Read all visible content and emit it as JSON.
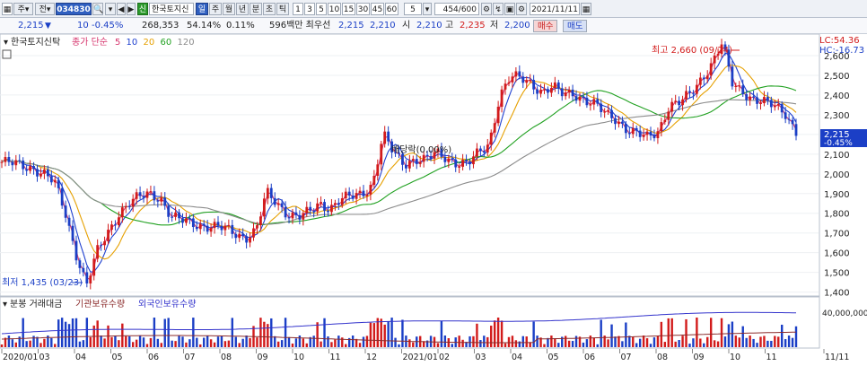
{
  "toolbar": {
    "market": "주",
    "prev_button": "전",
    "stock_code": "034830",
    "badge": "신",
    "stock_name": "한국토지신",
    "period_active": "일",
    "periods": [
      "주",
      "월",
      "년",
      "분",
      "초",
      "틱"
    ],
    "intervals": [
      "1",
      "3",
      "5",
      "10",
      "15",
      "30",
      "45",
      "60"
    ],
    "interval_value": "5",
    "count": "454",
    "count_total": "/600",
    "date": "2021/11/11"
  },
  "quote": {
    "price": "2,215",
    "direction": "▼",
    "change": "10",
    "change_pct": "-0.45%",
    "volume": "268,353",
    "turnover_pct": "54.14%",
    "vol_ratio": "0.11%",
    "amount": "596백만 최우선",
    "ask": "2,215",
    "bid": "2,210",
    "open_label": "시",
    "open": "2,210",
    "high_label": "고",
    "high": "2,235",
    "low_label": "저",
    "low": "2,200",
    "buy": "매수",
    "sell": "매도"
  },
  "legend": {
    "name": "한국토지신탁",
    "ma_label": "종가 단순",
    "ma": [
      {
        "period": "5",
        "color": "#d6336c"
      },
      {
        "period": "10",
        "color": "#1e3fcf"
      },
      {
        "period": "20",
        "color": "#e6a000"
      },
      {
        "period": "60",
        "color": "#21a121"
      },
      {
        "period": "120",
        "color": "#8c8c8c"
      }
    ]
  },
  "volume_legend": {
    "items": [
      "분봉 거래대금",
      "기관보유수량",
      "외국인보유수량"
    ],
    "colors": [
      "#d21b1b",
      "#8b2b2b",
      "#3333cc"
    ]
  },
  "annotations": {
    "high": "최고 2,660 (09/24)",
    "low": "최저 1,435 (03/23)",
    "dividend": "배당락(0.00%)"
  },
  "right_axis": {
    "lc": "LC:54.36",
    "hc": "HC:-16.73",
    "current_price": "2,215",
    "current_pct": "-0.45%",
    "volume_label": "40,000,000"
  },
  "x_axis": [
    "2020/01",
    "03",
    "04",
    "05",
    "06",
    "07",
    "08",
    "09",
    "10",
    "11",
    "12",
    "2021/01",
    "02",
    "03",
    "04",
    "05",
    "06",
    "07",
    "08",
    "09",
    "10",
    "11",
    "11/11"
  ],
  "chart_data": {
    "type": "candlestick",
    "x_ticks": [
      "2020/01",
      "03",
      "04",
      "05",
      "06",
      "07",
      "08",
      "09",
      "10",
      "11",
      "12",
      "2021/01",
      "02",
      "03",
      "04",
      "05",
      "06",
      "07",
      "08",
      "09",
      "10",
      "11"
    ],
    "y_ticks": [
      1400,
      1500,
      1600,
      1700,
      1800,
      1900,
      2000,
      2100,
      2200,
      2300,
      2400,
      2500,
      2600
    ],
    "ylim": [
      1380,
      2700
    ],
    "close_series": [
      2060,
      2050,
      2040,
      2030,
      2000,
      1950,
      1800,
      1600,
      1435,
      1600,
      1700,
      1800,
      1850,
      1880,
      1900,
      1880,
      1780,
      1760,
      1750,
      1740,
      1730,
      1720,
      1700,
      1680,
      1710,
      1900,
      1850,
      1800,
      1780,
      1800,
      1850,
      1830,
      1870,
      1880,
      1900,
      1950,
      2200,
      2100,
      2050,
      2080,
      2070,
      2100,
      2080,
      2060,
      2050,
      2100,
      2150,
      2400,
      2490,
      2480,
      2460,
      2420,
      2440,
      2400,
      2410,
      2380,
      2350,
      2300,
      2280,
      2230,
      2200,
      2180,
      2220,
      2350,
      2360,
      2400,
      2480,
      2560,
      2660,
      2450,
      2420,
      2380,
      2360,
      2340,
      2310,
      2215
    ],
    "low_marker": 1435,
    "high_marker": 2660,
    "last_close": 2215
  }
}
